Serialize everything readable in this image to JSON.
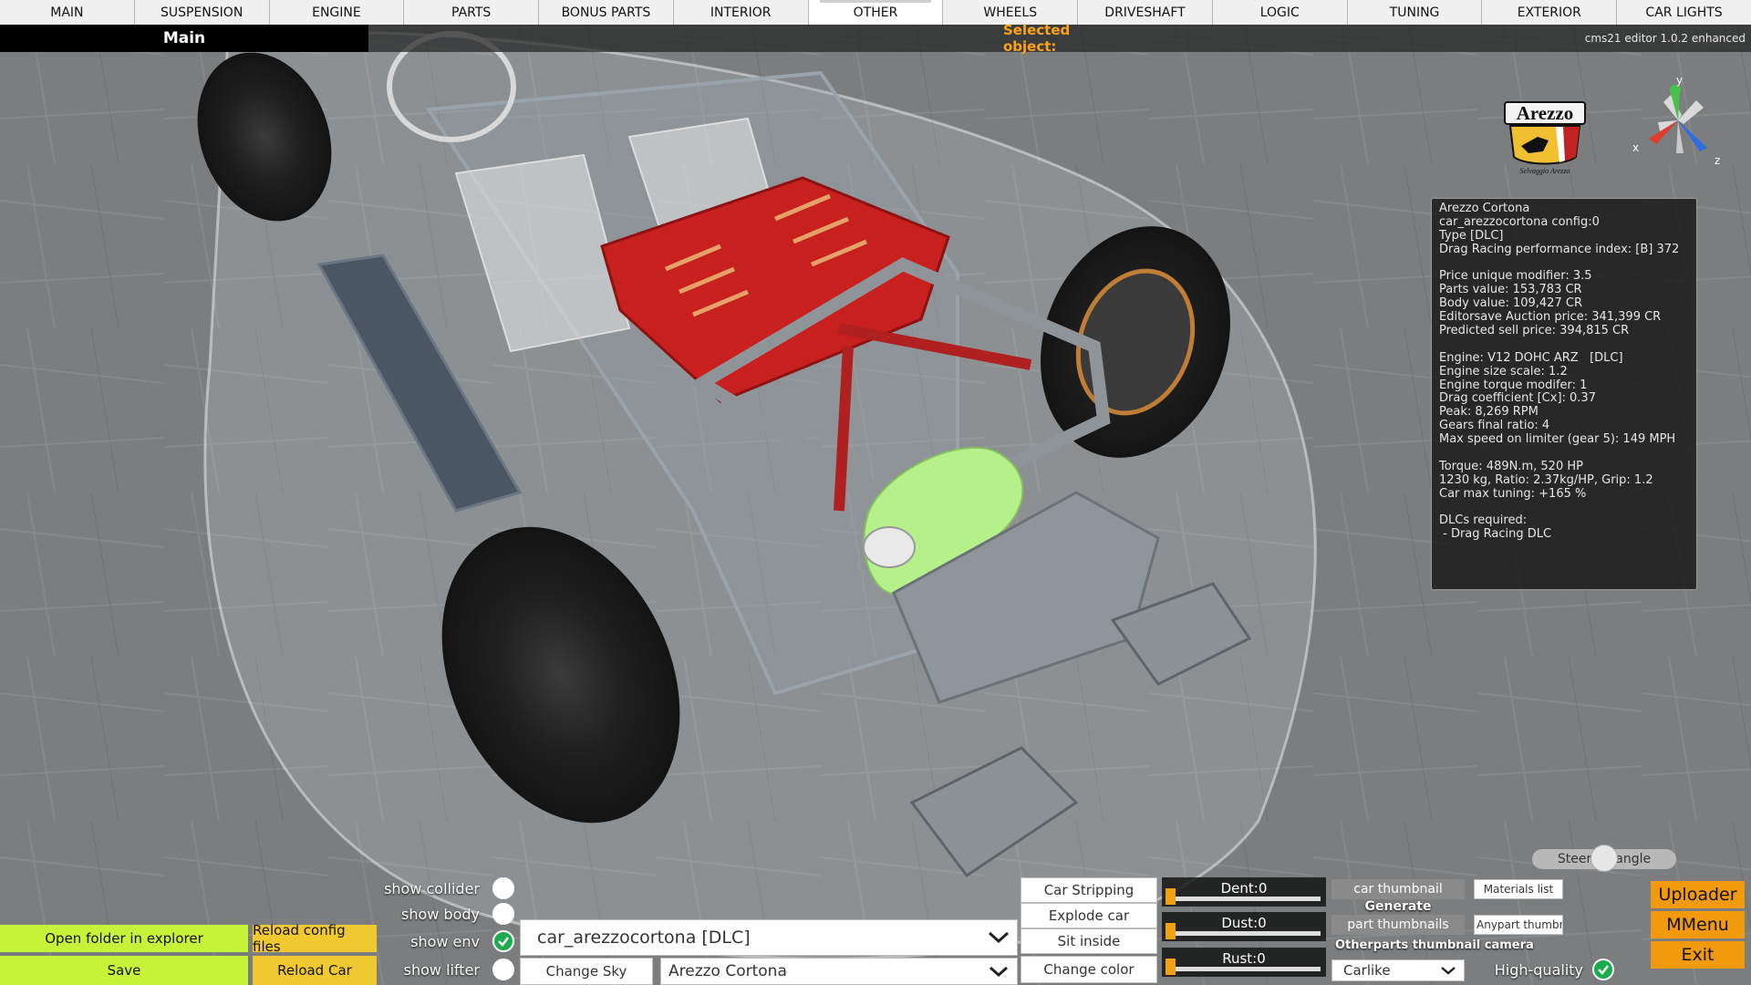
{
  "tabs": [
    "MAIN",
    "SUSPENSION",
    "ENGINE",
    "PARTS",
    "BONUS PARTS",
    "INTERIOR",
    "OTHER",
    "WHEELS",
    "DRIVESHAFT",
    "LOGIC",
    "TUNING",
    "EXTERIOR",
    "CAR LIGHTS"
  ],
  "active_tab": "OTHER",
  "header": {
    "main_label": "Main",
    "selected_object_label": "Selected object:",
    "version": "cms21 editor 1.0.2 enhanced"
  },
  "logo": {
    "brand": "Arezzo",
    "tagline": "Selvaggio Arezzo"
  },
  "gizmo": {
    "x": "x",
    "y": "y",
    "z": "z",
    "colors": {
      "x": "#e23b2e",
      "y": "#46c24a",
      "z": "#2f6ee0"
    }
  },
  "info_panel": {
    "lines": [
      "Arezzo Cortona",
      "car_arezzocortona config:0",
      "Type [DLC]",
      "Drag Racing performance index: [B] 372",
      "",
      "Price unique modifier: 3.5",
      "Parts value: 153,783 CR",
      "Body value: 109,427 CR",
      "Editorsave Auction price: 341,399 CR",
      "Predicted sell price: 394,815 CR",
      "",
      "Engine: V12 DOHC ARZ   [DLC]",
      "Engine size scale: 1.2",
      "Engine torque modifer: 1",
      "Drag coefficient [Cx]: 0.37",
      "Peak: 8,269 RPM",
      "Gears final ratio: 4",
      "Max speed on limiter (gear 5): 149 MPH",
      "",
      "Torque: 489N.m, 520 HP",
      "1230 kg, Ratio: 2.37kg/HP, Grip: 1.2",
      "Car max tuning: +165 %",
      "",
      "DLCs required:",
      " - Drag Racing DLC"
    ]
  },
  "toggles": [
    {
      "label": "show collider",
      "on": false
    },
    {
      "label": "show body",
      "on": false
    },
    {
      "label": "show env",
      "on": true
    },
    {
      "label": "show lifter",
      "on": false
    }
  ],
  "left_buttons": {
    "open_folder": "Open folder in explorer",
    "reload_config": "Reload config files",
    "save": "Save",
    "reload_car": "Reload Car"
  },
  "car_dropdown": {
    "value": "car_arezzocortona  [DLC]"
  },
  "change_sky": "Change Sky",
  "model_dropdown": {
    "value": "Arezzo Cortona"
  },
  "action_buttons": {
    "car_stripping": "Car Stripping",
    "explode_car": "Explode car",
    "sit_inside": "Sit inside",
    "change_color": "Change color"
  },
  "sliders": {
    "dent": {
      "label": "Dent:0",
      "value": 0
    },
    "dust": {
      "label": "Dust:0",
      "value": 0
    },
    "rust": {
      "label": "Rust:0",
      "value": 0
    }
  },
  "thumbnails": {
    "car_thumbnail": "car thumbnail",
    "generate": "Generate",
    "part_thumbnails": "part thumbnails",
    "camera_label": "Otherparts thumbnail camera",
    "camera_dropdown": "Carlike"
  },
  "lists": {
    "materials_list": "Materials list",
    "anypart_thumb": "Anypart thumbn"
  },
  "high_quality": {
    "label": "High-quality",
    "on": true
  },
  "right_menu": {
    "uploader": "Uploader",
    "mmenu": "MMenu",
    "exit": "Exit"
  },
  "steering": {
    "label": "Steering angle",
    "value": 0.5
  }
}
